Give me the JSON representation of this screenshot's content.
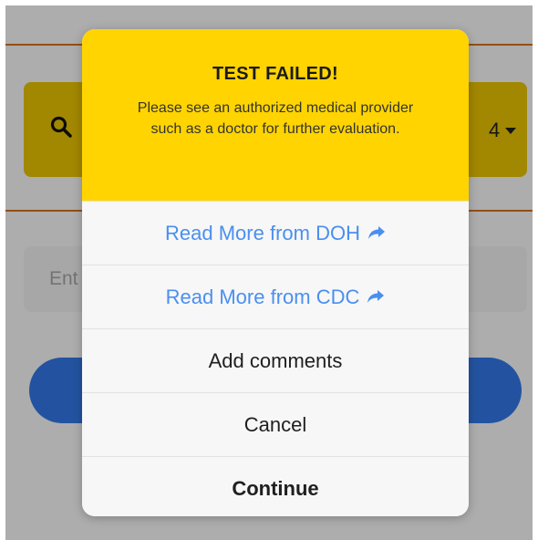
{
  "background": {
    "search_count": "4",
    "input_placeholder": "Ent"
  },
  "dialog": {
    "title": "TEST FAILED!",
    "message": "Please see an authorized medical provider such as a doctor for further evaluation.",
    "actions": [
      {
        "label": "Read More from DOH",
        "icon": "share-icon"
      },
      {
        "label": "Read More from CDC",
        "icon": "share-icon"
      },
      {
        "label": "Add comments"
      },
      {
        "label": "Cancel"
      },
      {
        "label": "Continue"
      }
    ]
  },
  "colors": {
    "header_yellow": "#ffd400",
    "link_blue": "#4a8ff0",
    "button_blue": "#2f6fd6",
    "divider_orange": "#c76a1a"
  }
}
